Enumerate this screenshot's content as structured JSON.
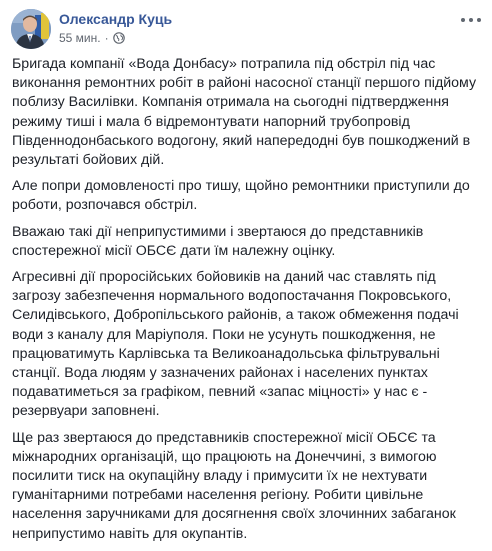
{
  "post": {
    "author": "Олександр Куць",
    "time": "55 мин.",
    "separator": "·",
    "privacy_icon": "globe-icon",
    "menu_icon": "more-options-icon",
    "paragraphs": [
      "Бригада компанії «Вода Донбасу» потрапила під обстріл під час виконання ремонтних робіт в районі насосної станції першого підйому поблизу Василівки. Компанія отримала на сьогодні підтвердження режиму тиші і мала б відремонтувати напорний трубопровід Південнодонбаського водогону, який напередодні був пошкоджений в результаті бойових дій.",
      "Але попри домовленості про тишу, щойно ремонтники приступили до роботи, розпочався обстріл.",
      "Вважаю такі дії неприпустимими і звертаюся до представників спостережної місії ОБСЄ дати їм належну оцінку.",
      "Агресивні дії проросійських бойовиків на даний час ставлять під загрозу забезпечення нормального водопостачання Покровського, Селидівського, Добропільського районів, а також обмеження подачі води з каналу для Маріуполя. Поки не усунуть пошкодження, не працюватимуть Карлівська та Великоанадольська фільтрувальні станції. Вода людям у зазначених районах і населених пунктах подаватиметься за графіком, певний «запас міцності» у нас є - резервуари заповнені.",
      "Ще раз звертаюся до представників спостережної місії ОБСЄ та міжнародних організацій, що працюють на Донеччині, з вимогою посилити тиск на окупаційну владу і примусити їх не нехтувати гуманітарними потребами населення регіону. Робити цивільне населення заручниками для досягнення своїх злочинних забаганок неприпустимо навіть для окупантів."
    ]
  }
}
